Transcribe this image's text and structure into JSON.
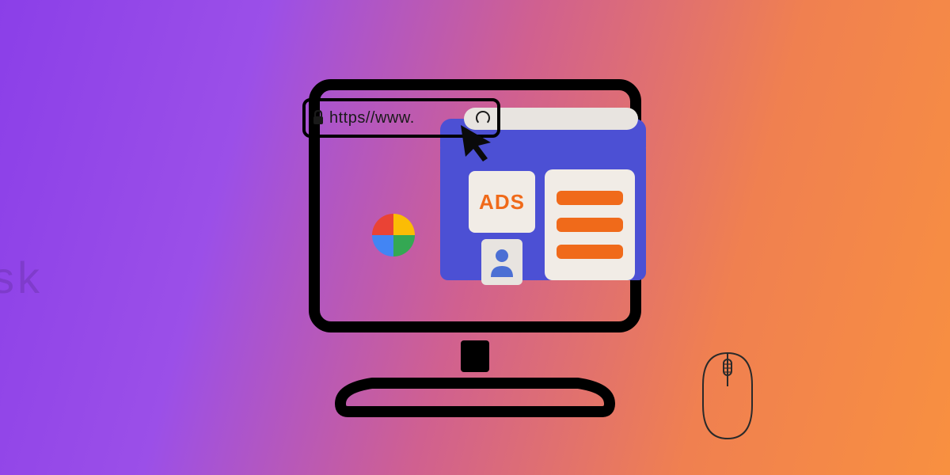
{
  "addressBar": {
    "url": "https//www.",
    "lockIcon": "lock-icon",
    "refreshIcon": "refresh-icon"
  },
  "ads": {
    "label": "ADS"
  },
  "menu": {
    "barCount": 3
  },
  "watermark": "sk",
  "colors": {
    "accent": "#F06A1A",
    "window": "#4C50D4",
    "card": "#F1ECE6",
    "pinwheel": {
      "red": "#EA4335",
      "yellow": "#FBBC05",
      "green": "#34A853",
      "blue": "#4285F4"
    }
  }
}
